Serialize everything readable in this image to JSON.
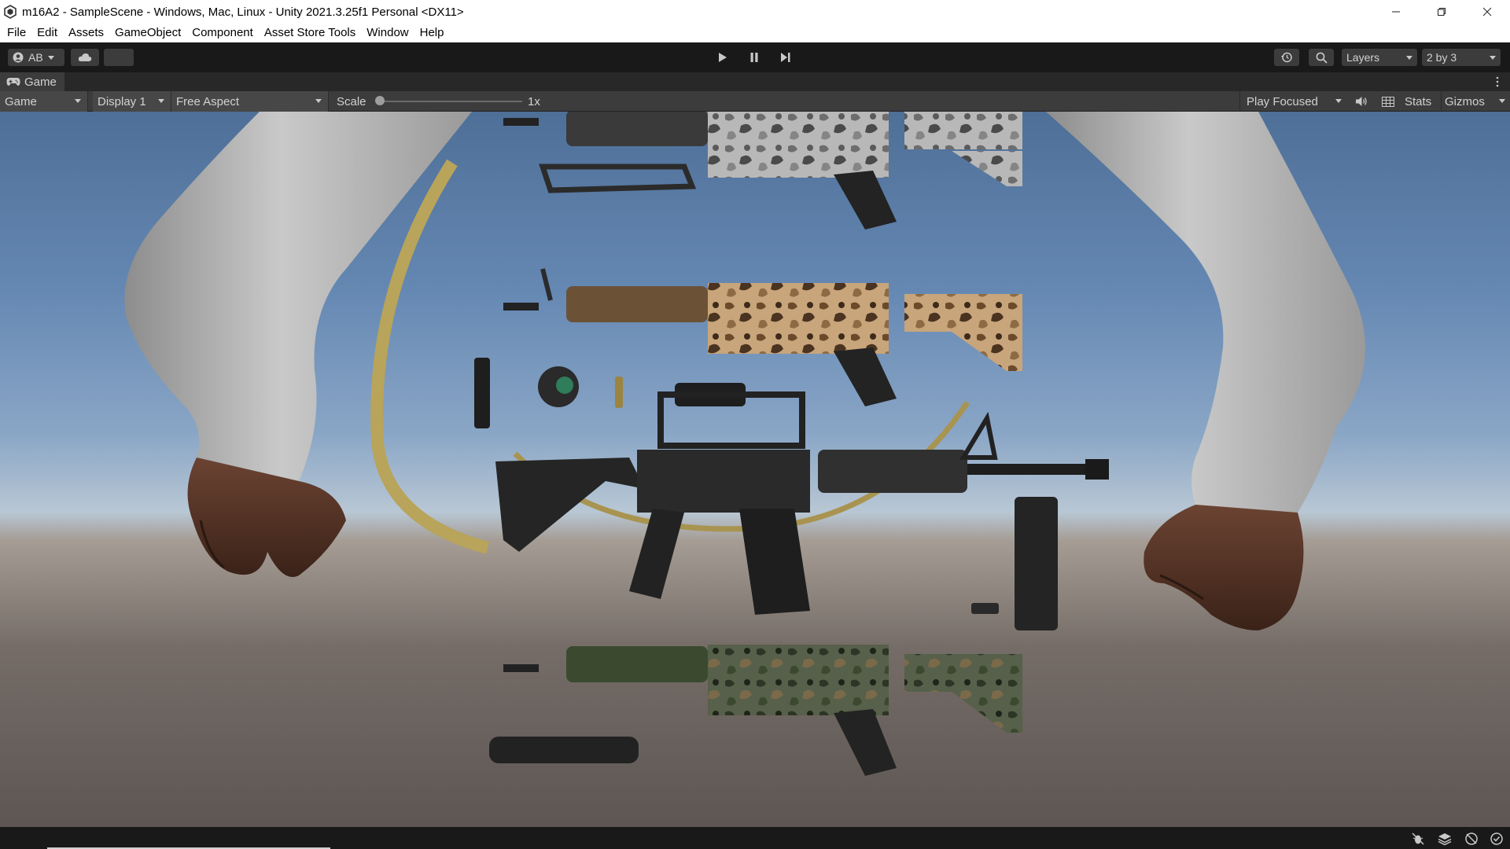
{
  "window": {
    "title": "m16A2 - SampleScene - Windows, Mac, Linux - Unity 2021.3.25f1 Personal <DX11>",
    "app_icon": "unity-icon",
    "controls": [
      "minimize-icon",
      "restore-icon",
      "close-icon"
    ]
  },
  "menu": {
    "items": [
      "File",
      "Edit",
      "Assets",
      "GameObject",
      "Component",
      "Asset Store Tools",
      "Window",
      "Help"
    ]
  },
  "toolbar": {
    "account_label": "AB",
    "account_icon": "account-icon",
    "cloud_icon": "cloud-icon",
    "play_icon": "play-icon",
    "pause_icon": "pause-icon",
    "step_icon": "step-icon",
    "history_icon": "history-icon",
    "search_icon": "search-icon",
    "layers_label": "Layers",
    "layout_label": "2 by 3"
  },
  "game_tab": {
    "label": "Game",
    "icon": "gamepad-icon"
  },
  "game_bar": {
    "view_select": "Game",
    "display_select": "Display 1",
    "aspect_select": "Free Aspect",
    "scale_label": "Scale",
    "scale_value": "1x",
    "play_mode_select": "Play Focused",
    "mute_icon": "speaker-icon",
    "stats_icon": "grid-icon",
    "stats_label": "Stats",
    "gizmos_label": "Gizmos"
  },
  "status_bar": {
    "icons": [
      "bug-icon",
      "layers-icon",
      "network-icon",
      "check-icon"
    ]
  },
  "colors": {
    "editor_bg": "#191919",
    "panel_bg": "#3c3c3c",
    "tab_bg": "#282828",
    "text": "#d2d2d2",
    "sky_top": "#4e6f97",
    "ground": "#5d5653"
  }
}
